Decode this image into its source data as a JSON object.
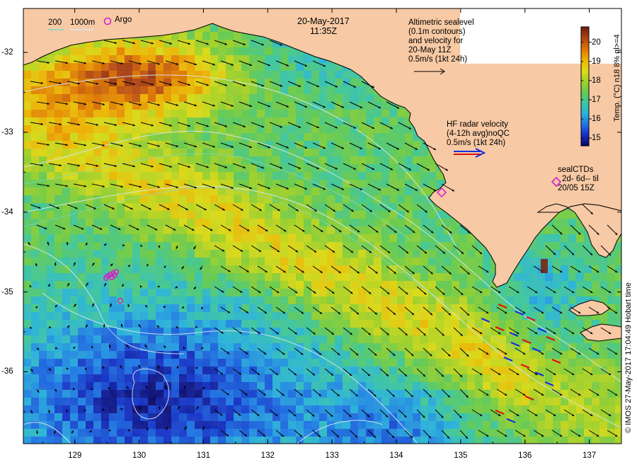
{
  "title": {
    "date": "20-May-2017",
    "time": "11:35Z"
  },
  "bathymetry_legend": {
    "label_200": "200",
    "label_1000": "1000m",
    "argo_label": "Argo",
    "argo_color": "#d21ed2"
  },
  "altimetry_note": {
    "lines": [
      "Altimetric sealevel",
      "(0.1m contours)",
      "and velocity for",
      "20-May 11Z",
      "0.5m/s (1kt 24h)"
    ]
  },
  "hf_radar_note": {
    "lines": [
      "HF radar velocity",
      "(4-12h avg)noQC",
      "0.5m/s (1kt 24h)"
    ],
    "arrow_colors": [
      "#1030e0",
      "#e01010"
    ]
  },
  "sealctd_note": {
    "lines": [
      "sealCTDs",
      "2d- 6d-- til",
      "20/05 15Z"
    ],
    "marker_color": "#d21ed2"
  },
  "axes": {
    "x_ticks": [
      "129",
      "130",
      "131",
      "132",
      "133",
      "134",
      "135",
      "136",
      "137"
    ],
    "y_ticks": [
      "-32",
      "-33",
      "-34",
      "-35",
      "-36"
    ],
    "x_range": [
      128.2,
      137.5
    ],
    "y_range": [
      -36.9,
      -31.45
    ]
  },
  "colorbar": {
    "label": "Temp. (°C) n18 8% ql>=4",
    "ticks": [
      "15",
      "16",
      "17",
      "18",
      "19",
      "20"
    ],
    "range": [
      14.6,
      20.8
    ],
    "colors": [
      "#0a0a6e",
      "#1432c8",
      "#1e78e6",
      "#28b4dc",
      "#3cc8a0",
      "#64cc50",
      "#a0d228",
      "#dcdc14",
      "#f0b400",
      "#e07800",
      "#b44614",
      "#7a2008"
    ]
  },
  "credit": {
    "text": "© IMOS 27-May-2017 17:04:49 Hobart time"
  },
  "colors": {
    "land": "#f7c9a4",
    "coast": "#000000",
    "sea_contour": "#d8e8f0",
    "isobath": "#7fd8d0",
    "arrow": "#000000"
  }
}
